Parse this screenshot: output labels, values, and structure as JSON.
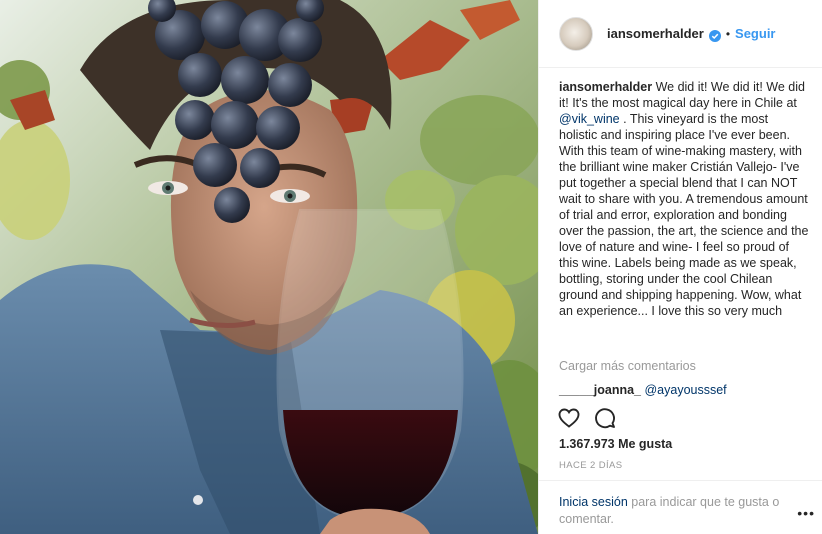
{
  "post": {
    "username": "iansomerhalder",
    "separator": "•",
    "follow_label": "Seguir",
    "caption_user": "iansomerhalder",
    "caption_part1": " We did it! We did it! We did it! It's the most magical day here in Chile at ",
    "caption_mention": "@vik_wine",
    "caption_part2": " . This vineyard is the most holistic and inspiring place I've ever been. With this team of wine-making mastery, with the brilliant wine maker Cristián Vallejo- I've put together a special blend that I can NOT wait to share with you. A tremendous amount of trial and error, exploration and bonding over the passion, the art, the science and the love of nature and wine- I feel so proud of this wine. Labels being made as we speak, bottling, storing under the cool Chilean ground and shipping happening. Wow, what an experience... I love this so very much",
    "load_more_comments": "Cargar más comentarios",
    "comment_user": "_____joanna_",
    "comment_mention": "@ayayousssef",
    "likes": "1.367.973 Me gusta",
    "time_ago": "HACE 2 DÍAS",
    "login_link": "Inicia sesión",
    "login_rest": " para indicar que te gusta o comentar.",
    "more_options": "•••"
  },
  "icons": {
    "verified": "verified-badge-icon",
    "like": "heart-icon",
    "comment": "comment-bubble-icon",
    "options": "more-options-icon"
  },
  "colors": {
    "link_blue": "#3897f0",
    "mention": "#003569",
    "muted": "#999999",
    "text": "#262626",
    "divider": "#efefef"
  }
}
